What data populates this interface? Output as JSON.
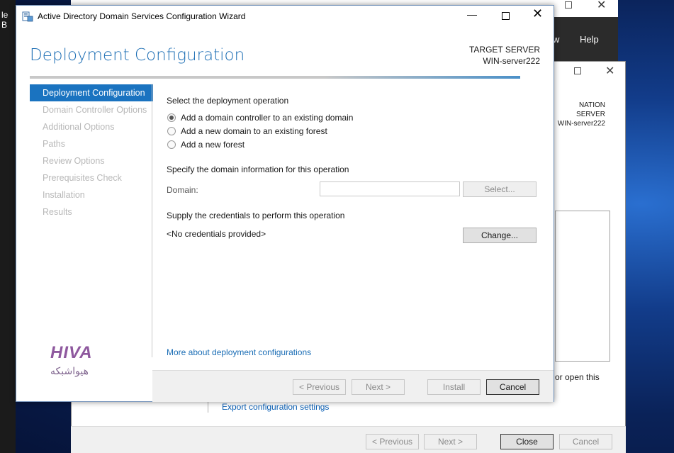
{
  "background": {
    "left_strip_text": "le B",
    "server_manager": {
      "menu_view": "w",
      "menu_help": "Help"
    },
    "add_roles_wizard": {
      "destination_label": "NATION SERVER",
      "destination_server": "WIN-server222",
      "open_text": "or open this",
      "export_link": "Export configuration settings",
      "buttons": {
        "previous": "< Previous",
        "next": "Next >",
        "close": "Close",
        "cancel": "Cancel"
      }
    }
  },
  "wizard": {
    "title": "Active Directory Domain Services Configuration Wizard",
    "heading": "Deployment Configuration",
    "target_server_label": "TARGET SERVER",
    "target_server_name": "WIN-server222",
    "nav": [
      {
        "label": "Deployment Configuration",
        "active": true
      },
      {
        "label": "Domain Controller Options",
        "active": false
      },
      {
        "label": "Additional Options",
        "active": false
      },
      {
        "label": "Paths",
        "active": false
      },
      {
        "label": "Review Options",
        "active": false
      },
      {
        "label": "Prerequisites Check",
        "active": false
      },
      {
        "label": "Installation",
        "active": false
      },
      {
        "label": "Results",
        "active": false
      }
    ],
    "deployment": {
      "label": "Select the deployment operation",
      "options": [
        {
          "label": "Add a domain controller to an existing domain",
          "checked": true
        },
        {
          "label": "Add a new domain to an existing forest",
          "checked": false
        },
        {
          "label": "Add a new forest",
          "checked": false
        }
      ]
    },
    "domain_info": {
      "label": "Specify the domain information for this operation",
      "domain_label": "Domain:",
      "domain_value": "",
      "select_button": "Select..."
    },
    "credentials": {
      "label": "Supply the credentials to perform this operation",
      "status": "<No credentials provided>",
      "change_button": "Change..."
    },
    "more_link": "More about deployment configurations",
    "buttons": {
      "previous": "< Previous",
      "next": "Next >",
      "install": "Install",
      "cancel": "Cancel"
    }
  },
  "watermark": {
    "logo": "HIVA",
    "subtitle": "هیواشبکه"
  },
  "colors": {
    "accent": "#1a73c0",
    "heading": "#1e6fb5",
    "link": "#1a6db5"
  }
}
